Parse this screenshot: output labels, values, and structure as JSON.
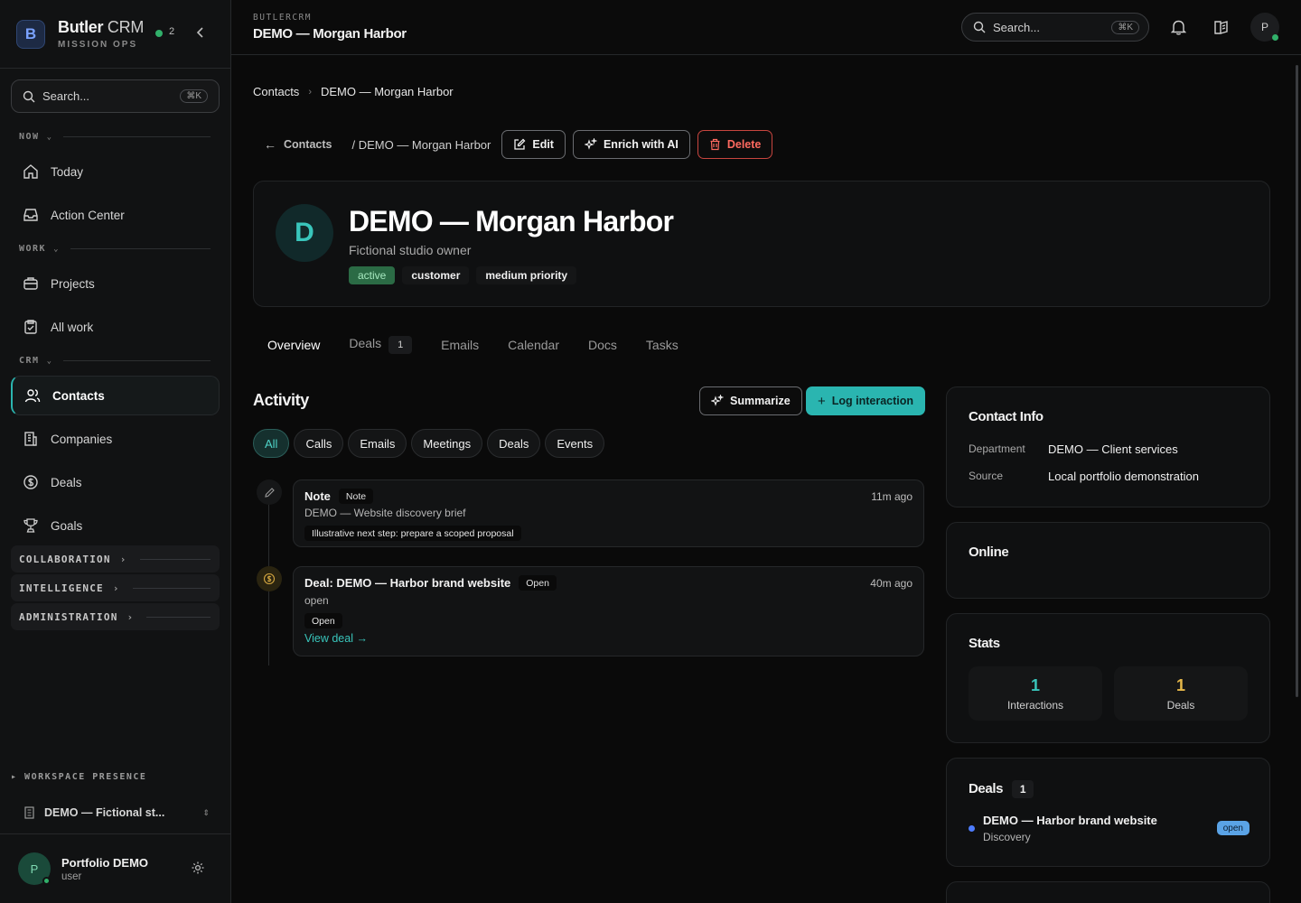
{
  "brand": {
    "name_bold": "Butler",
    "name_light": "CRM",
    "subtitle": "MISSION OPS",
    "logo_letter": "B",
    "online_count": "2"
  },
  "sidebar": {
    "search_placeholder": "Search...",
    "search_kbd": "⌘K",
    "sections": {
      "now": "NOW",
      "work": "WORK",
      "crm": "CRM"
    },
    "items": [
      {
        "label": "Today",
        "icon": "home-icon"
      },
      {
        "label": "Action Center",
        "icon": "inbox-icon"
      },
      {
        "label": "Projects",
        "icon": "briefcase-icon"
      },
      {
        "label": "All work",
        "icon": "clipboard-icon"
      },
      {
        "label": "Contacts",
        "icon": "users-icon",
        "active": true
      },
      {
        "label": "Companies",
        "icon": "building-icon"
      },
      {
        "label": "Deals",
        "icon": "dollar-icon"
      },
      {
        "label": "Goals",
        "icon": "trophy-icon"
      }
    ],
    "groups": {
      "collaboration": "COLLABORATION",
      "intelligence": "INTELLIGENCE",
      "administration": "ADMINISTRATION"
    },
    "presence_label": "WORKSPACE PRESENCE",
    "workspace": "DEMO — Fictional st...",
    "user": {
      "initial": "P",
      "name": "Portfolio DEMO",
      "role": "user"
    }
  },
  "topbar": {
    "crumb": "BUTLERCRM",
    "title": "DEMO — Morgan Harbor",
    "search_placeholder": "Search...",
    "search_kbd": "⌘K",
    "avatar_initial": "P"
  },
  "breadcrumb": {
    "parent": "Contacts",
    "current": "DEMO — Morgan Harbor"
  },
  "actions": {
    "back": "Contacts",
    "slash_title": "/ DEMO — Morgan Harbor",
    "edit": "Edit",
    "enrich": "Enrich with AI",
    "delete": "Delete"
  },
  "profile": {
    "initial": "D",
    "name": "DEMO — Morgan Harbor",
    "subtitle": "Fictional studio owner",
    "tags": [
      "active",
      "customer",
      "medium priority"
    ]
  },
  "tabs": {
    "overview": "Overview",
    "deals": "Deals",
    "deals_count": "1",
    "emails": "Emails",
    "calendar": "Calendar",
    "docs": "Docs",
    "tasks": "Tasks"
  },
  "activity": {
    "title": "Activity",
    "summarize": "Summarize",
    "log": "Log interaction",
    "filters": [
      "All",
      "Calls",
      "Emails",
      "Meetings",
      "Deals",
      "Events"
    ],
    "items": [
      {
        "title": "Note",
        "badge": "Note",
        "time": "11m ago",
        "desc": "DEMO — Website discovery brief",
        "pill": "Illustrative next step: prepare a scoped proposal"
      },
      {
        "title": "Deal: DEMO — Harbor brand website",
        "badge": "Open",
        "time": "40m ago",
        "desc": "open",
        "pill": "Open",
        "link": "View deal →"
      }
    ]
  },
  "contact_info": {
    "title": "Contact Info",
    "department_label": "Department",
    "department": "DEMO — Client services",
    "source_label": "Source",
    "source": "Local portfolio demonstration"
  },
  "online": {
    "title": "Online"
  },
  "stats": {
    "title": "Stats",
    "interactions": "1",
    "interactions_label": "Interactions",
    "deals": "1",
    "deals_label": "Deals"
  },
  "deals_card": {
    "title": "Deals",
    "count": "1",
    "deal_name": "DEMO — Harbor brand website",
    "deal_stage": "Discovery",
    "deal_status": "open"
  },
  "colors": {
    "accent": "#2ab5b0",
    "danger": "#ff6a60",
    "green": "#31b06a",
    "stat_teal": "#39c5bb",
    "stat_gold": "#e6b84a"
  }
}
